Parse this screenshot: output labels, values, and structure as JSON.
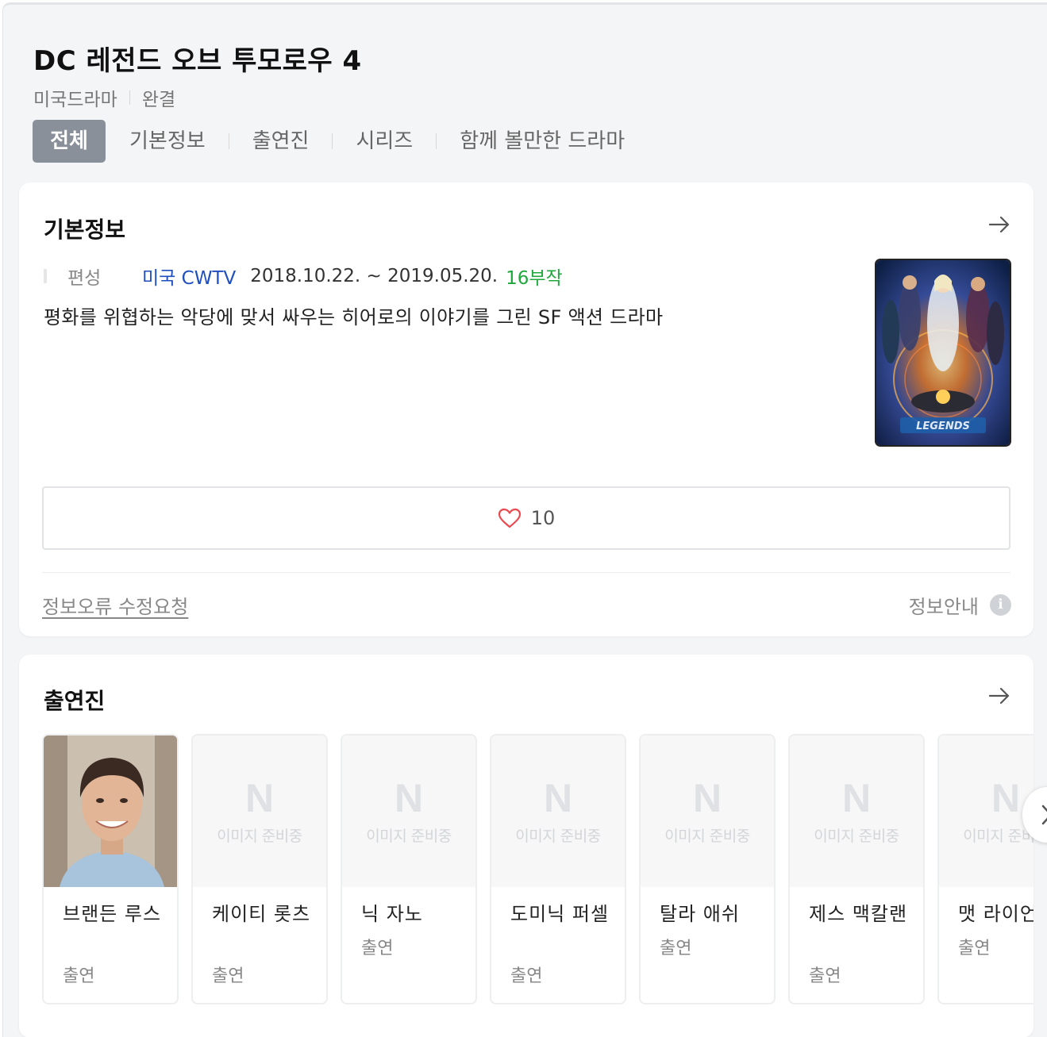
{
  "header": {
    "title": "DC 레전드 오브 투모로우 4",
    "category": "미국드라마",
    "status": "완결"
  },
  "tabs": [
    {
      "label": "전체",
      "active": true
    },
    {
      "label": "기본정보",
      "active": false
    },
    {
      "label": "출연진",
      "active": false
    },
    {
      "label": "시리즈",
      "active": false
    },
    {
      "label": "함께 볼만한 드라마",
      "active": false
    }
  ],
  "basic_info": {
    "section_title": "기본정보",
    "label": "편성",
    "channel": "미국 CWTV",
    "date_range": "2018.10.22. ~ 2019.05.20.",
    "episodes": "16부작",
    "synopsis": "평화를 위협하는 악당에 맞서 싸우는 히어로의 이야기를 그린 SF 액션 드라마",
    "likes": "10",
    "report_link": "정보오류 수정요청",
    "info_guide": "정보안내",
    "info_icon": "i"
  },
  "cast_section": {
    "section_title": "출연진",
    "placeholder_logo": "N",
    "placeholder_text": "이미지 준비중",
    "members": [
      {
        "name": "브랜든 루스",
        "role": "출연",
        "has_photo": true
      },
      {
        "name": "케이티 롯츠",
        "role": "출연",
        "has_photo": false
      },
      {
        "name": "닉 자노",
        "role": "출연",
        "has_photo": false
      },
      {
        "name": "도미닉 퍼셀",
        "role": "출연",
        "has_photo": false
      },
      {
        "name": "탈라 애쉬",
        "role": "출연",
        "has_photo": false
      },
      {
        "name": "제스 맥칼랜",
        "role": "출연",
        "has_photo": false
      },
      {
        "name": "맷 라이언",
        "role": "출연",
        "has_photo": false
      }
    ]
  },
  "colors": {
    "channel": "#1f4fbf",
    "episodes": "#1ea83c",
    "active_tab": "#8a9099",
    "heart": "#e9494f"
  }
}
